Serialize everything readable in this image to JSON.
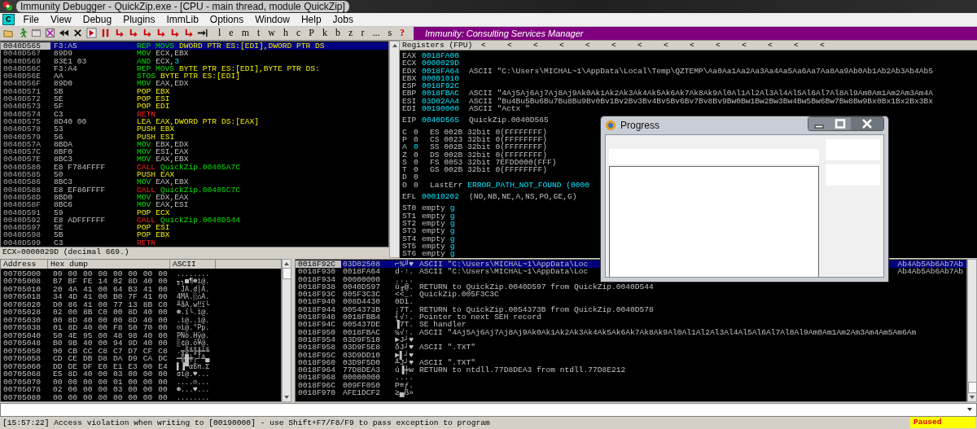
{
  "window": {
    "title": "Immunity Debugger - QuickZip.exe - [CPU - main thread, module QuickZip]"
  },
  "menu": {
    "logo": "C",
    "items": [
      "File",
      "View",
      "Debug",
      "Plugins",
      "ImmLib",
      "Options",
      "Window",
      "Help",
      "Jobs"
    ]
  },
  "toolbar": {
    "letters": [
      {
        "text": "l",
        "kind": "view"
      },
      {
        "text": "e",
        "kind": "view"
      },
      {
        "text": "m",
        "kind": "view"
      },
      {
        "text": "t",
        "kind": "view"
      },
      {
        "text": "w",
        "kind": "view"
      },
      {
        "text": "h",
        "kind": "view"
      },
      {
        "text": "c",
        "kind": "view"
      },
      {
        "text": "P",
        "kind": "view"
      },
      {
        "text": "k",
        "kind": "view"
      },
      {
        "text": "b",
        "kind": "view"
      },
      {
        "text": "z",
        "kind": "view"
      },
      {
        "text": "r",
        "kind": "view"
      },
      {
        "text": "...",
        "kind": "view"
      },
      {
        "text": "s",
        "kind": "view"
      },
      {
        "text": "?",
        "kind": "help"
      }
    ],
    "banner": "Immunity: Consulting Services Manager"
  },
  "disassembly": {
    "rows": [
      {
        "address": "0040D565",
        "hex": "F3:A5",
        "mnemonic": "REP MOVS",
        "operands": "DWORD PTR ES:[EDI],DWORD PTR DS",
        "kind": "string",
        "selected": true
      },
      {
        "address": "0040D567",
        "hex": "89D9",
        "mnemonic": "MOV",
        "operands": "ECX,EBX",
        "kind": "move",
        "selected": false
      },
      {
        "address": "0040D569",
        "hex": "83E1 03",
        "mnemonic": "AND",
        "operands": "ECX,",
        "constant": "3",
        "kind": "move",
        "selected": false
      },
      {
        "address": "0040D56C",
        "hex": "F3:A4",
        "mnemonic": "REP MOVS",
        "operands": "BYTE PTR ES:[EDI],BYTE PTR DS:",
        "kind": "string",
        "selected": false
      },
      {
        "address": "0040D56E",
        "hex": "AA",
        "mnemonic": "STOS",
        "operands": "BYTE PTR ES:[EDI]",
        "kind": "string",
        "selected": false
      },
      {
        "address": "0040D56F",
        "hex": "89D0",
        "mnemonic": "MOV",
        "operands": "EAX,EDX",
        "kind": "move",
        "selected": false
      },
      {
        "address": "0040D571",
        "hex": "5B",
        "mnemonic": "POP",
        "operands": "EBX",
        "kind": "stack",
        "selected": false
      },
      {
        "address": "0040D572",
        "hex": "5E",
        "mnemonic": "POP",
        "operands": "ESI",
        "kind": "stack",
        "selected": false
      },
      {
        "address": "0040D573",
        "hex": "5F",
        "mnemonic": "POP",
        "operands": "EDI",
        "kind": "stack",
        "selected": false
      },
      {
        "address": "0040D574",
        "hex": "C3",
        "mnemonic": "RETN",
        "kind": "return",
        "selected": false
      },
      {
        "address": "0040D575",
        "hex": "8D40 00",
        "mnemonic": "LEA",
        "operands": "EAX,DWORD PTR DS:[EAX]",
        "kind": "address",
        "selected": false
      },
      {
        "address": "0040D578",
        "hex": "53",
        "mnemonic": "PUSH",
        "operands": "EBX",
        "kind": "stack",
        "selected": false
      },
      {
        "address": "0040D579",
        "hex": "56",
        "mnemonic": "PUSH",
        "operands": "ESI",
        "kind": "stack",
        "selected": false
      },
      {
        "address": "0040D57A",
        "hex": "8BDA",
        "mnemonic": "MOV",
        "operands": "EBX,EDX",
        "kind": "move",
        "selected": false
      },
      {
        "address": "0040D57C",
        "hex": "8BF0",
        "mnemonic": "MOV",
        "operands": "ESI,EAX",
        "kind": "move",
        "selected": false
      },
      {
        "address": "0040D57E",
        "hex": "8BC3",
        "mnemonic": "MOV",
        "operands": "EAX,EBX",
        "kind": "move",
        "selected": false
      },
      {
        "address": "0040D580",
        "hex": "E8 F784FFFF",
        "mnemonic": "CALL",
        "operands": "QuickZip.00405A7C",
        "kind": "call",
        "selected": false
      },
      {
        "address": "0040D585",
        "hex": "50",
        "mnemonic": "PUSH",
        "operands": "EAX",
        "kind": "stack",
        "selected": false
      },
      {
        "address": "0040D586",
        "hex": "8BC3",
        "mnemonic": "MOV",
        "operands": "EAX,EBX",
        "kind": "move",
        "selected": false
      },
      {
        "address": "0040D588",
        "hex": "E8 EF86FFFF",
        "mnemonic": "CALL",
        "operands": "QuickZip.00405C7C",
        "kind": "call",
        "selected": false
      },
      {
        "address": "0040D58D",
        "hex": "8BD0",
        "mnemonic": "MOV",
        "operands": "EDX,EAX",
        "kind": "move",
        "selected": false
      },
      {
        "address": "0040D58F",
        "hex": "8BC6",
        "mnemonic": "MOV",
        "operands": "EAX,ESI",
        "kind": "move",
        "selected": false
      },
      {
        "address": "0040D591",
        "hex": "59",
        "mnemonic": "POP",
        "operands": "ECX",
        "kind": "stack",
        "selected": false
      },
      {
        "address": "0040D592",
        "hex": "E8 ADFFFFFF",
        "mnemonic": "CALL",
        "operands": "QuickZip.0040D544",
        "kind": "call",
        "selected": false
      },
      {
        "address": "0040D597",
        "hex": "5E",
        "mnemonic": "POP",
        "operands": "ESI",
        "kind": "stack",
        "selected": false
      },
      {
        "address": "0040D598",
        "hex": "5B",
        "mnemonic": "POP",
        "operands": "EBX",
        "kind": "stack",
        "selected": false
      },
      {
        "address": "0040D599",
        "hex": "C3",
        "mnemonic": "RETN",
        "kind": "return",
        "selected": false
      }
    ],
    "info": "ECX=0000029D (decimal 669.)"
  },
  "registers": {
    "title": "Registers (FPU)",
    "arrows": [
      "<",
      "<",
      "<",
      "<",
      "<",
      "<",
      "<",
      "<",
      "<",
      "<",
      "<",
      "<",
      "<",
      "<"
    ],
    "general": [
      {
        "name": "EAX",
        "value": "0018FA00"
      },
      {
        "name": "ECX",
        "value": "0000029D"
      },
      {
        "name": "EDX",
        "value": "0018FA64",
        "comment": "ASCII \"C:\\Users\\MICHAL~1\\AppData\\Local\\Temp\\QZTEMP\\Aa0Aa1Aa2Aa3Aa4Aa5Aa6Aa7Aa8Aa9Ab0Ab1Ab2Ab3Ab4Ab5"
      },
      {
        "name": "EBX",
        "value": "00001010"
      },
      {
        "name": "ESP",
        "value": "0018F92C"
      },
      {
        "name": "EBP",
        "value": "0018FBAC",
        "comment": "ASCII \"4Aj5Aj6Aj7Aj8Aj9Ak0Ak1Ak2Ak3Ak4Ak5Ak6Ak7Ak8Ak9Al0Al1Al2Al3Al4Al5Al6Al7Al8Al9Am0Am1Am2Am3Am4A"
      },
      {
        "name": "ESI",
        "value": "03D02AA4",
        "comment": "ASCII \"Bu4Bu5Bu6Bu7Bu8Bu9Bv0Bv1Bv2Bv3Bv4Bv5Bv6Bv7Bv8Bv9Bw0Bw1Bw2Bw3Bw4Bw5Bw6Bw7Bw8Bw9Bx0Bx1Bx2Bx3Bx"
      },
      {
        "name": "EDI",
        "value": "00190000",
        "comment": "ASCII \"Actx \""
      }
    ],
    "eip": {
      "name": "EIP",
      "value": "0040D565",
      "comment": "QuickZip.0040D565"
    },
    "flags": [
      {
        "flag": "C",
        "value": "0",
        "changed": false,
        "text": "ES 002B 32bit 0(FFFFFFFF)"
      },
      {
        "flag": "P",
        "value": "0",
        "changed": false,
        "text": "CS 0023 32bit 0(FFFFFFFF)"
      },
      {
        "flag": "A",
        "value": "0",
        "changed": true,
        "text": "SS 002B 32bit 0(FFFFFFFF)"
      },
      {
        "flag": "Z",
        "value": "0",
        "changed": false,
        "text": "DS 002B 32bit 0(FFFFFFFF)"
      },
      {
        "flag": "S",
        "value": "0",
        "changed": false,
        "text": "FS 0053 32bit 7EFDD000(FFF)"
      },
      {
        "flag": "T",
        "value": "0",
        "changed": false,
        "text": "GS 002B 32bit 0(FFFFFFFF)"
      },
      {
        "flag": "D",
        "value": "0",
        "changed": false
      },
      {
        "flag": "O",
        "value": "0",
        "changed": false,
        "text": "LastErr",
        "detail": "ERROR_PATH_NOT_FOUND (0000"
      }
    ],
    "efl": {
      "name": "EFL",
      "value": "00010202",
      "comment": "(NO,NB,NE,A,NS,PO,GE,G)"
    },
    "fpu": [
      {
        "name": "ST0",
        "state": "empty",
        "tag": "g"
      },
      {
        "name": "ST1",
        "state": "empty",
        "tag": "g"
      },
      {
        "name": "ST2",
        "state": "empty",
        "tag": "g"
      },
      {
        "name": "ST3",
        "state": "empty",
        "tag": "g"
      },
      {
        "name": "ST4",
        "state": "empty",
        "tag": "g"
      },
      {
        "name": "ST5",
        "state": "empty",
        "tag": "g"
      },
      {
        "name": "ST6",
        "state": "empty",
        "tag": "g"
      }
    ]
  },
  "dump": {
    "columns": [
      "Address",
      "Hex dump",
      "ASCII"
    ],
    "rows": [
      {
        "address": "00705000",
        "hex": "00 00 00 00 00 00 00 00",
        "ascii": "........"
      },
      {
        "address": "00705008",
        "hex": "B7 BF FE 14 02 8D 40 00",
        "ascii": "╖┐■¶☻ì@."
      },
      {
        "address": "00705010",
        "hex": "20 4A 41 00 64 B3 41 00",
        "ascii": " JA.d│A."
      },
      {
        "address": "00705018",
        "hex": "34 4D 41 00 B0 7F 41 00",
        "ascii": "4MA.░⌂A."
      },
      {
        "address": "00705020",
        "hex": "D0 86 41 00 77 13 8B C0",
        "ascii": "╨åA.w‼ï└"
      },
      {
        "address": "00705028",
        "hex": "02 00 8B C0 00 8D 40 00",
        "ascii": "☻.ï└.ì@."
      },
      {
        "address": "00705030",
        "hex": "00 8D 40 00 00 8D 40 00",
        "ascii": ".ì@..ì@."
      },
      {
        "address": "00705038",
        "hex": "01 8D 40 00 F8 50 70 00",
        "ascii": "☺ì@.°Pp."
      },
      {
        "address": "00705040",
        "hex": "50 4E 95 00 48 98 40 00",
        "ascii": "PNò.Hÿ@."
      },
      {
        "address": "00705048",
        "hex": "B0 9B 40 00 94 9D 40 00",
        "ascii": "░¢@.ö¥@."
      },
      {
        "address": "00705050",
        "hex": "00 CB CC C8 C7 D7 CF C8",
        "ascii": ".╦╠╚╟╫╧╚"
      },
      {
        "address": "00705058",
        "hex": "CD CE DB D8 DA D9 CA DC",
        "ascii": "═╬█╪┌┘╩▄"
      },
      {
        "address": "00705060",
        "hex": "DD DE DF E0 E1 E3 00 E4",
        "ascii": "▌▐▀αßπ.Σ"
      },
      {
        "address": "00705068",
        "hex": "E5 8D 40 00 03 00 00 00",
        "ascii": "σì@.♥..."
      },
      {
        "address": "00705070",
        "hex": "00 00 00 00 01 00 00 00",
        "ascii": "....☺..."
      },
      {
        "address": "00705078",
        "hex": "02 00 00 00 03 00 00 00",
        "ascii": "☻...♥..."
      },
      {
        "address": "00705080",
        "hex": "00 00 00 00 00 00 00 00",
        "ascii": "........"
      }
    ]
  },
  "stack": {
    "rows": [
      {
        "address": "0018F92C",
        "value": "03D02508",
        "chars": "⌐%╜♥",
        "comment": "ASCII \"C:\\Users\\MICHAL~1\\AppData\\Loc",
        "tail": "Ab4Ab5Ab6Ab7Ab",
        "selected": true
      },
      {
        "address": "0018F930",
        "value": "0018FA64",
        "chars": "d·↑.",
        "comment": "ASCII \"C:\\Users\\MICHAL~1\\AppData\\Loc",
        "tail": "Ab4Ab5Ab6Ab7Ab",
        "selected": false
      },
      {
        "address": "0018F934",
        "value": "00000000",
        "chars": "....",
        "selected": false
      },
      {
        "address": "0018F938",
        "value": "0040D597",
        "chars": "ù╓@.",
        "comment": "RETURN to QuickZip.0040D597 from QuickZip.0040D544",
        "selected": false
      },
      {
        "address": "0018F93C",
        "value": "005F3C3C",
        "chars": "<<_.",
        "comment": "QuickZip.005F3C3C",
        "selected": false
      },
      {
        "address": "0018F940",
        "value": "008D4430",
        "chars": "0Dì.",
        "selected": false
      },
      {
        "address": "0018F944",
        "value": "0054373B",
        "chars": ";7T.",
        "comment": "RETURN to QuickZip.0054373B from QuickZip.0040D578",
        "selected": false
      },
      {
        "address": "0018F948",
        "value": "0018FBB4",
        "chars": "┤√↑.",
        "comment": "Pointer to next SEH record",
        "selected": false
      },
      {
        "address": "0018F94C",
        "value": "005437DE",
        "chars": "▐7T.",
        "comment": "SE handler",
        "selected": false
      },
      {
        "address": "0018F950",
        "value": "0018FBAC",
        "chars": "¼√↑.",
        "comment": "ASCII \"4Aj5Aj6Aj7Aj8Aj9Ak0Ak1Ak2Ak3Ak4Ak5Ak6Ak7Ak8Ak9Al0Al1Al2Al3Al4Al5Al6Al7Al8Al9Am0Am1Am2Am3Am4Am5Am6Am",
        "selected": false
      },
      {
        "address": "0018F954",
        "value": "03D9F510",
        "chars": "►J┘♥",
        "selected": false
      },
      {
        "address": "0018F958",
        "value": "03D9F5E8",
        "chars": "δJ┘♥",
        "comment": "ASCII \".TXT\"",
        "selected": false
      },
      {
        "address": "0018F95C",
        "value": "03D9DD10",
        "chars": "►▌┘♥",
        "selected": false
      },
      {
        "address": "0018F960",
        "value": "03D9F5D0",
        "chars": "╨J┘♥",
        "comment": "ASCII \".TXT\"",
        "selected": false
      },
      {
        "address": "0018F964",
        "value": "77D8DEA3",
        "chars": "ú▐╪w",
        "comment": "RETURN to ntdll.77D8DEA3 from ntdll.77D8E212",
        "selected": false
      },
      {
        "address": "0018F968",
        "value": "00000000",
        "chars": "....",
        "selected": false
      },
      {
        "address": "0018F96C",
        "value": "009FF050",
        "chars": "P≡ƒ.",
        "selected": false
      },
      {
        "address": "0018F970",
        "value": "AFE1DCF2",
        "chars": "≥▄ß»",
        "selected": false
      }
    ]
  },
  "progress_window": {
    "title": "Progress"
  },
  "status_bar": {
    "message": "[15:57:22] Access violation when writing to [00190000] - use Shift+F7/F8/F9 to pass exception to program",
    "state": "Paused"
  }
}
